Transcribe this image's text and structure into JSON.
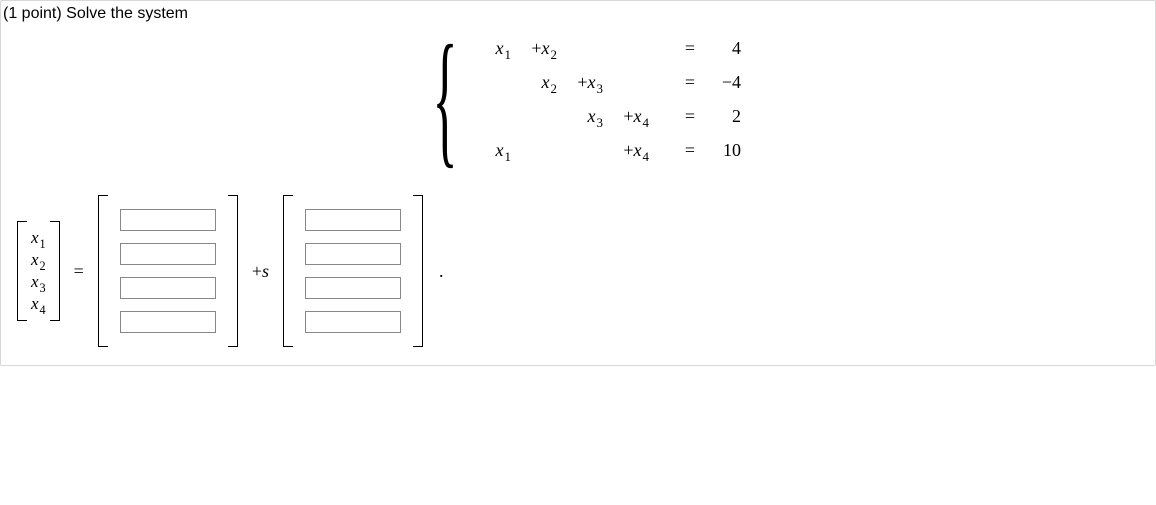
{
  "prompt": {
    "points_label": "(1 point)",
    "text": "Solve the system"
  },
  "system": {
    "rows": [
      {
        "c1": "x1",
        "c2": "+x2",
        "c3": "",
        "c4": "",
        "eq": "=",
        "rhs": "4"
      },
      {
        "c1": "",
        "c2": "x2",
        "c3": "+x3",
        "c4": "",
        "eq": "=",
        "rhs": "-4"
      },
      {
        "c1": "",
        "c2": "",
        "c3": "x3",
        "c4": "+x4",
        "eq": "=",
        "rhs": "2"
      },
      {
        "c1": "x1",
        "c2": "",
        "c3": "",
        "c4": "+x4",
        "eq": "=",
        "rhs": "10"
      }
    ]
  },
  "answer": {
    "labels": [
      "x1",
      "x2",
      "x3",
      "x4"
    ],
    "equals": "=",
    "plus_s": "+s",
    "period": ".",
    "num_inputs_each": 4
  },
  "chart_data": {
    "type": "table",
    "title": "Linear system Ax = b",
    "variables": [
      "x1",
      "x2",
      "x3",
      "x4"
    ],
    "equations": [
      {
        "coeffs": [
          1,
          1,
          0,
          0
        ],
        "rhs": 4
      },
      {
        "coeffs": [
          0,
          1,
          1,
          0
        ],
        "rhs": -4
      },
      {
        "coeffs": [
          0,
          0,
          1,
          1
        ],
        "rhs": 2
      },
      {
        "coeffs": [
          1,
          0,
          0,
          1
        ],
        "rhs": 10
      }
    ]
  }
}
